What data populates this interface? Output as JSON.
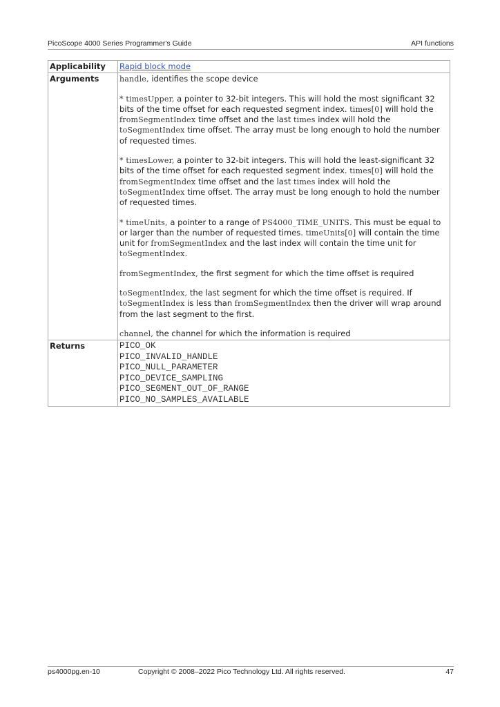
{
  "header": {
    "left": "PicoScope 4000 Series Programmer's Guide",
    "right": "API functions"
  },
  "table": {
    "applicability_label": "Applicability",
    "applicability_value": "Rapid block mode",
    "arguments_label": "Arguments",
    "args": {
      "handle_name": "handle,",
      "handle_desc": " identifies the scope device",
      "upper_name": "* timesUpper,",
      "upper_desc1": " a pointer to 32-bit integers. This will hold the most significant 32 bits of the time offset for each requested segment index. ",
      "upper_code1": "times[0]",
      "upper_desc2": " will hold the ",
      "upper_code2": "fromSegmentIndex",
      "upper_desc3": " time offset and the last ",
      "upper_code3": "times",
      "upper_desc4": " index will hold the ",
      "upper_code4": "toSegmentIndex",
      "upper_desc5": " time offset. The array must be long enough to hold the number of requested times.",
      "lower_name": "* timesLower,",
      "lower_desc1": " a pointer to 32-bit integers. This will hold the least-significant 32 bits of the time offset for each requested segment index. ",
      "lower_code1": "times[0]",
      "lower_desc2": " will hold the ",
      "lower_code2": "fromSegmentIndex",
      "lower_desc3": " time offset and the last ",
      "lower_code3": "times",
      "lower_desc4": " index will hold the ",
      "lower_code4": "toSegmentIndex",
      "lower_desc5": " time offset. The array must be long enough to hold the number of requested times.",
      "units_name": "* timeUnits,",
      "units_desc1": " a pointer to a range of ",
      "units_code1": "PS4000_TIME_UNITS",
      "units_desc2": ". This must be equal to or larger than the number of requested times. ",
      "units_code2": "timeUnits[0]",
      "units_desc3": " will contain the time unit for ",
      "units_code3": "fromSegmentIndex",
      "units_desc4": " and the last index will contain the time unit for ",
      "units_code4": "toSegmentIndex",
      "units_desc5": ".",
      "from_name": "fromSegmentIndex,",
      "from_desc": " the first segment for which the time offset is required",
      "to_name": "toSegmentIndex,",
      "to_desc1": " the last segment for which the time offset is required. If ",
      "to_code1": "toSegmentIndex",
      "to_desc2": " is less than ",
      "to_code2": "fromSegmentIndex",
      "to_desc3": " then the driver will wrap around from the last segment to the first.",
      "channel_name": "channel,",
      "channel_desc": " the channel for which the information is required"
    },
    "returns_label": "Returns",
    "returns": [
      "PICO_OK",
      "PICO_INVALID_HANDLE",
      "PICO_NULL_PARAMETER",
      "PICO_DEVICE_SAMPLING",
      "PICO_SEGMENT_OUT_OF_RANGE",
      "PICO_NO_SAMPLES_AVAILABLE"
    ]
  },
  "footer": {
    "left": "ps4000pg.en-10",
    "center": "Copyright © 2008–2022 Pico Technology Ltd. All rights reserved.",
    "page": "47"
  }
}
